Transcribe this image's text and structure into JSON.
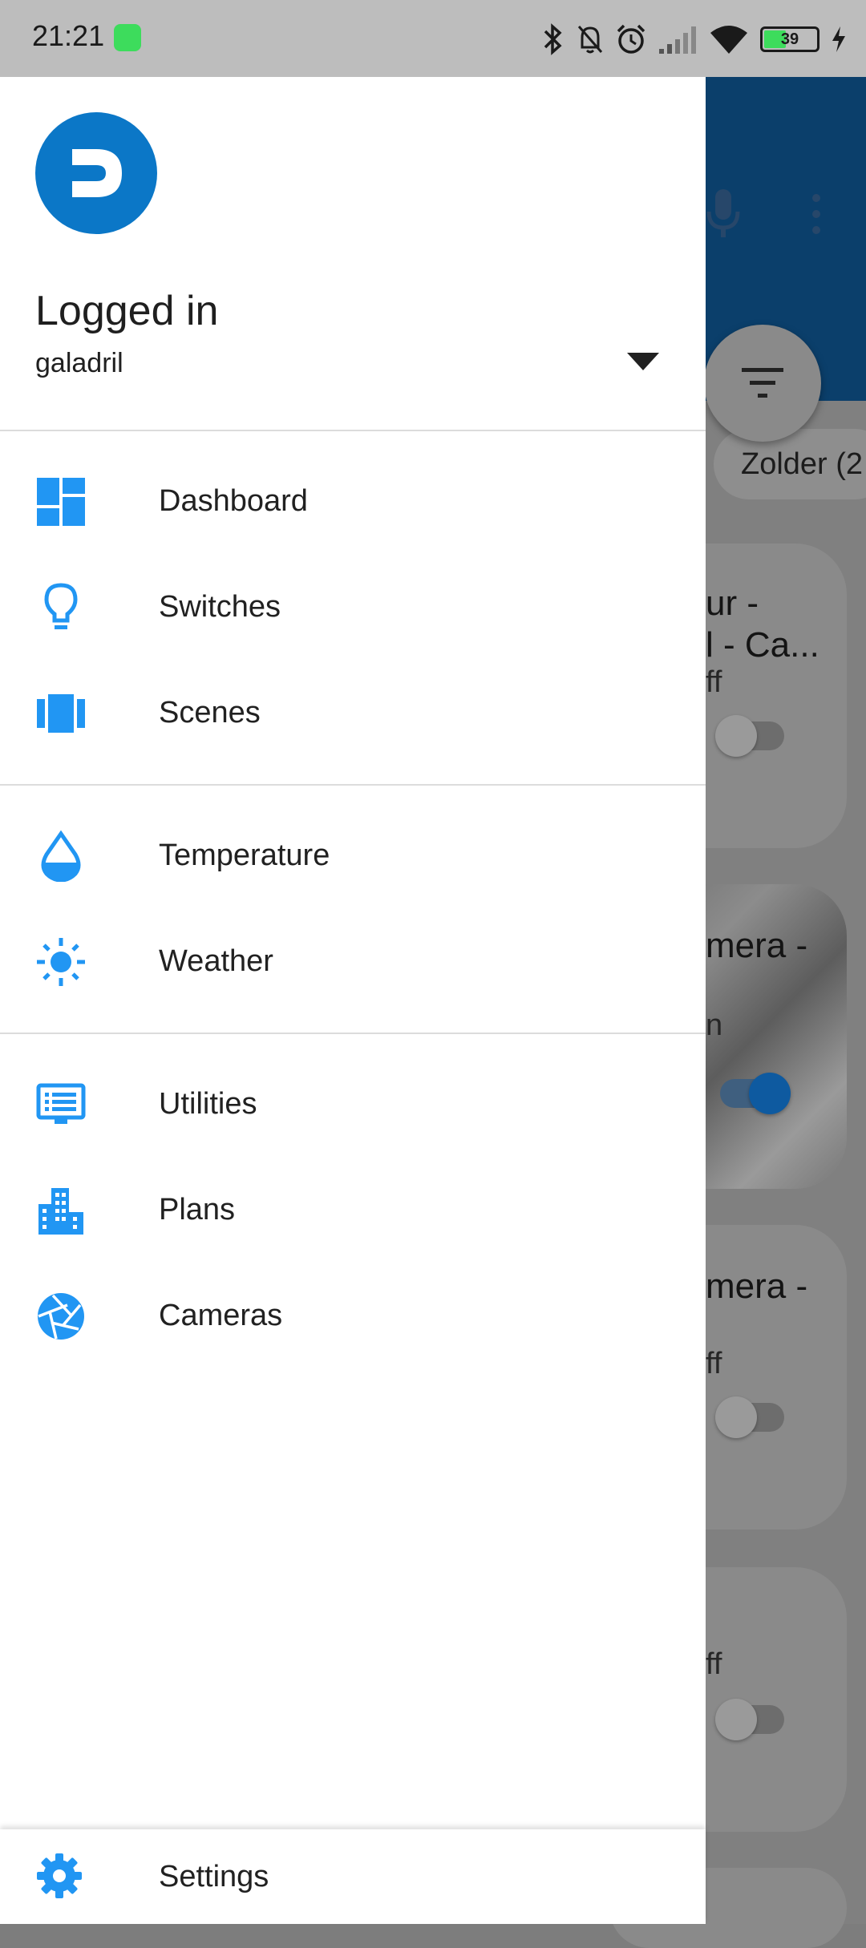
{
  "status_bar": {
    "time": "21:21",
    "battery_level": "39"
  },
  "background": {
    "filter_chip": "Zolder (2",
    "cards": [
      {
        "title_line1": "ur -",
        "title_line2": "l - Ca...",
        "state": "ff",
        "toggle_on": false
      },
      {
        "title_line1": "mera -",
        "title_line2": "",
        "state": "n",
        "toggle_on": true
      },
      {
        "title_line1": "mera -",
        "title_line2": "",
        "state": "ff",
        "toggle_on": false
      },
      {
        "title_line1": "",
        "title_line2": "",
        "state": "ff",
        "toggle_on": false
      }
    ]
  },
  "drawer": {
    "header": {
      "title": "Logged in",
      "username": "galadril"
    },
    "sections": [
      {
        "items": [
          {
            "label": "Dashboard",
            "icon": "dashboard-icon"
          },
          {
            "label": "Switches",
            "icon": "lightbulb-icon"
          },
          {
            "label": "Scenes",
            "icon": "scenes-icon"
          }
        ]
      },
      {
        "items": [
          {
            "label": "Temperature",
            "icon": "temperature-drop-icon"
          },
          {
            "label": "Weather",
            "icon": "sun-icon"
          }
        ]
      },
      {
        "items": [
          {
            "label": "Utilities",
            "icon": "utilities-icon"
          },
          {
            "label": "Plans",
            "icon": "building-icon"
          },
          {
            "label": "Cameras",
            "icon": "camera-aperture-icon"
          }
        ]
      }
    ],
    "footer": {
      "settings_label": "Settings"
    }
  },
  "colors": {
    "accent": "#2196f3",
    "avatar": "#0b77c7",
    "status_bar": "#bdbdbd",
    "scrim_topbar": "#0b3f6b"
  }
}
